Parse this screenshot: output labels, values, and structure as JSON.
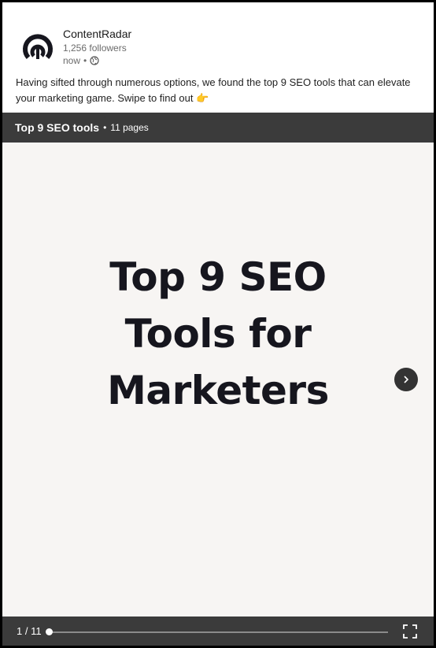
{
  "post": {
    "author": "ContentRadar",
    "followers": "1,256 followers",
    "time": "now",
    "time_separator": "•",
    "text": "Having sifted through numerous options, we found the top 9 SEO tools that can elevate your marketing game. Swipe to find out 👉"
  },
  "document": {
    "title": "Top 9 SEO tools",
    "separator": "•",
    "pages": "11 pages",
    "slide_title_line1": "Top 9 SEO",
    "slide_title_line2": "Tools for",
    "slide_title_line3": "Marketers",
    "page_indicator": "1 / 11",
    "progress": 0.0
  },
  "icons": {
    "avatar": "contentradar-logo-icon",
    "visibility": "globe-icon",
    "next": "chevron-right-icon",
    "fullscreen": "fullscreen-icon"
  },
  "colors": {
    "bar_background": "#3b3b3b",
    "slide_background": "#f7f5f3",
    "slide_text": "#16161e"
  }
}
